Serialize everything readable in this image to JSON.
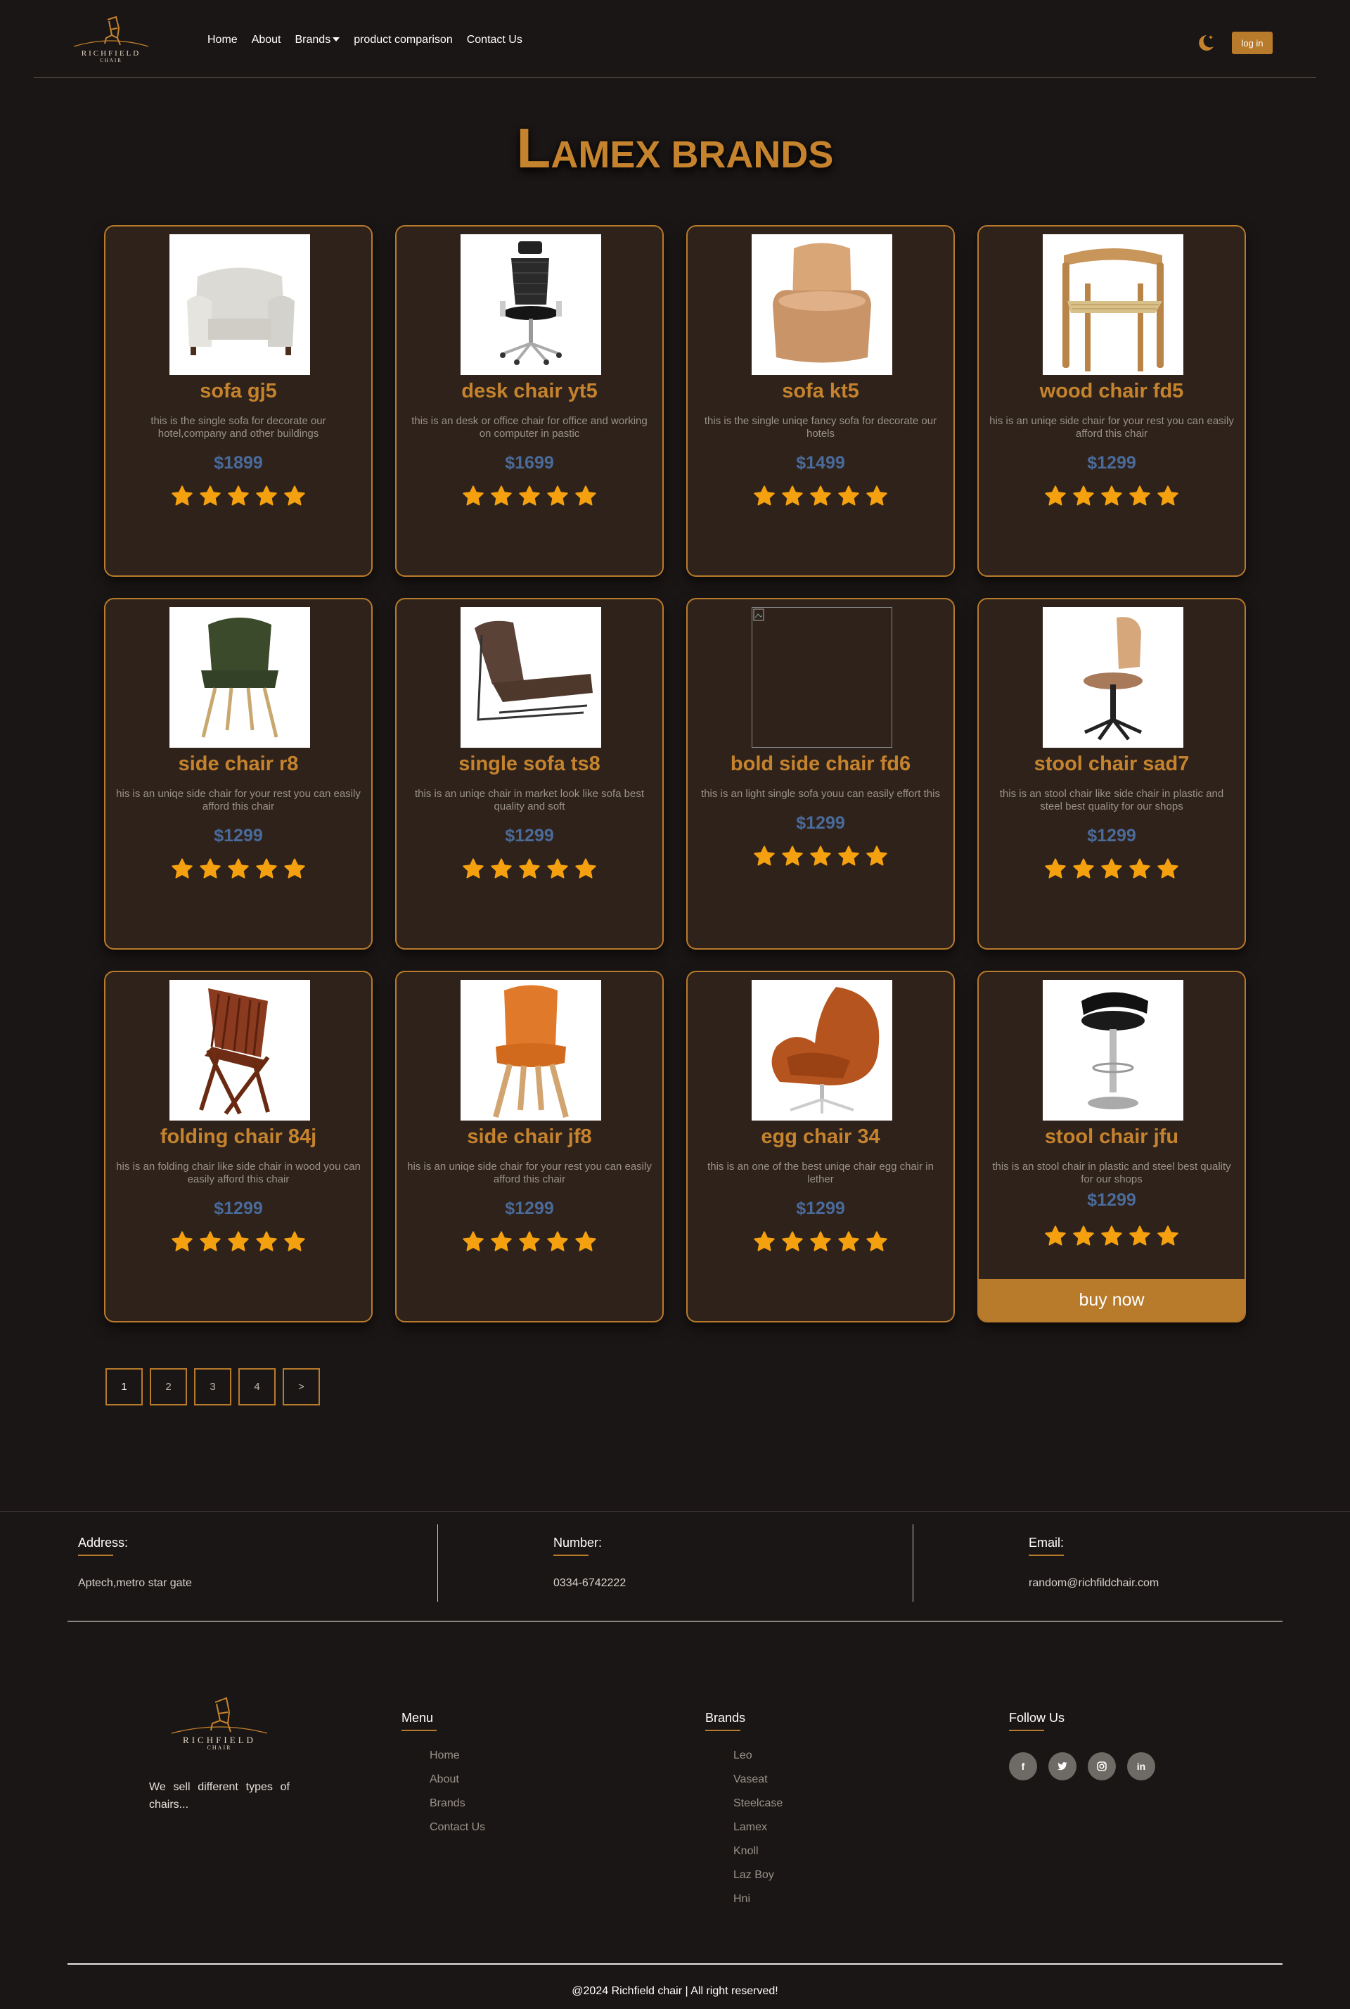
{
  "nav": {
    "logo_text": "RICHFIELD",
    "logo_sub": "CHAIR",
    "links": [
      "Home",
      "About",
      "Brands",
      "product comparison",
      "Contact Us"
    ],
    "login_label": "log in",
    "theme_icon": "moon-stars-icon"
  },
  "page": {
    "heading_first": "L",
    "heading_rest": "amex brands"
  },
  "colors": {
    "background": "#1a1615",
    "accent": "#b87a2b",
    "card": "#2e221a",
    "price": "#4a6a9a",
    "star": "#f5a00f"
  },
  "products": [
    {
      "name": "sofa gj5",
      "desc": "this is the single sofa for decorate our hotel,company and other buildings",
      "price": "$1899",
      "rating": 5,
      "image": "armchair"
    },
    {
      "name": "desk chair yt5",
      "desc": "this is an desk or office chair for office and working on computer in pastic",
      "price": "$1699",
      "rating": 5,
      "image": "office-chair"
    },
    {
      "name": "sofa kt5",
      "desc": "this is the single uniqe fancy sofa for decorate our hotels",
      "price": "$1499",
      "rating": 5,
      "image": "round-chair"
    },
    {
      "name": "wood chair fd5",
      "desc": "his is an uniqe side chair for your rest you can easily afford this chair",
      "price": "$1299",
      "rating": 5,
      "image": "wood-chair"
    },
    {
      "name": "side chair r8",
      "desc": "his is an uniqe side chair for your rest you can easily afford this chair",
      "price": "$1299",
      "rating": 5,
      "image": "green-chair"
    },
    {
      "name": "single sofa ts8",
      "desc": "this is an uniqe chair in market look like sofa best quality and soft",
      "price": "$1299",
      "rating": 5,
      "image": "lounge-chair"
    },
    {
      "name": "bold side chair fd6",
      "desc": "this is an light single sofa youu can easily effort this",
      "price": "$1299",
      "rating": 5,
      "image": "broken"
    },
    {
      "name": "stool chair sad7",
      "desc": "this is an stool chair like side chair in plastic and steel best quality for our shops",
      "price": "$1299",
      "rating": 5,
      "image": "stool-chair"
    },
    {
      "name": "folding chair 84j",
      "desc": "his is an folding chair like side chair in wood you can easily afford this chair",
      "price": "$1299",
      "rating": 5,
      "image": "folding-chair"
    },
    {
      "name": "side chair jf8",
      "desc": "his is an uniqe side chair for your rest you can easily afford this chair",
      "price": "$1299",
      "rating": 5,
      "image": "orange-chair"
    },
    {
      "name": "egg chair 34",
      "desc": "this is an one of the best uniqe chair egg chair in lether",
      "price": "$1299",
      "rating": 5,
      "image": "egg-chair"
    },
    {
      "name": "stool chair jfu",
      "desc": "this is an stool chair in plastic and steel best quality for our shops",
      "price": "$1299",
      "rating": 5,
      "image": "bar-stool",
      "buy_label": "buy now"
    }
  ],
  "pagination": [
    "1",
    "2",
    "3",
    "4",
    ">"
  ],
  "contact": {
    "address_label": "Address:",
    "address_value": "Aptech,metro star gate",
    "number_label": "Number:",
    "number_value": "0334-6742222",
    "email_label": "Email:",
    "email_value": "random@richfildchair.com"
  },
  "footer": {
    "about": "We sell different types of chairs...",
    "menu_title": "Menu",
    "menu": [
      "Home",
      "About",
      "Brands",
      "Contact Us"
    ],
    "brands_title": "Brands",
    "brands": [
      "Leo",
      "Vaseat",
      "Steelcase",
      "Lamex",
      "Knoll",
      "Laz Boy",
      "Hni"
    ],
    "follow_title": "Follow Us",
    "socials": [
      "facebook-icon",
      "twitter-icon",
      "instagram-icon",
      "linkedin-icon"
    ],
    "copyright": "@2024 Richfield chair | All right reserved!"
  }
}
